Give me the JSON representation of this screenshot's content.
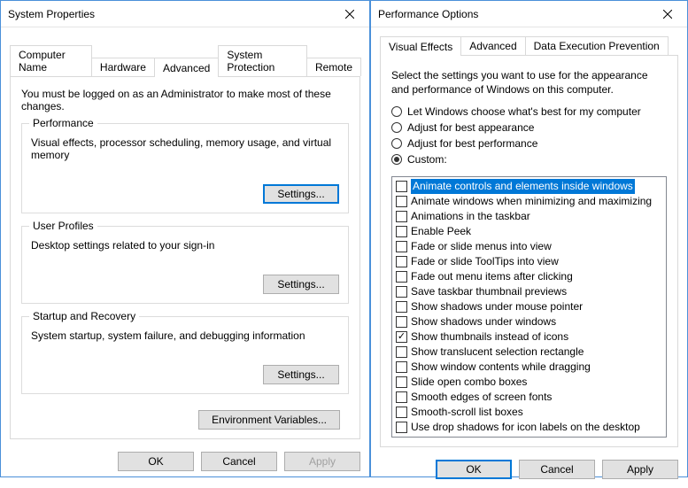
{
  "left": {
    "title": "System Properties",
    "tabs": [
      "Computer Name",
      "Hardware",
      "Advanced",
      "System Protection",
      "Remote"
    ],
    "active_tab": 2,
    "intro": "You must be logged on as an Administrator to make most of these changes.",
    "groups": {
      "performance": {
        "legend": "Performance",
        "desc": "Visual effects, processor scheduling, memory usage, and virtual memory",
        "button": "Settings..."
      },
      "userprofiles": {
        "legend": "User Profiles",
        "desc": "Desktop settings related to your sign-in",
        "button": "Settings..."
      },
      "startup": {
        "legend": "Startup and Recovery",
        "desc": "System startup, system failure, and debugging information",
        "button": "Settings..."
      }
    },
    "envbtn": "Environment Variables...",
    "footer": {
      "ok": "OK",
      "cancel": "Cancel",
      "apply": "Apply"
    }
  },
  "right": {
    "title": "Performance Options",
    "tabs": [
      "Visual Effects",
      "Advanced",
      "Data Execution Prevention"
    ],
    "active_tab": 0,
    "instr": "Select the settings you want to use for the appearance and performance of Windows on this computer.",
    "radios": [
      {
        "label": "Let Windows choose what's best for my computer",
        "selected": false
      },
      {
        "label": "Adjust for best appearance",
        "selected": false
      },
      {
        "label": "Adjust for best performance",
        "selected": false
      },
      {
        "label": "Custom:",
        "selected": true
      }
    ],
    "checks": [
      {
        "label": "Animate controls and elements inside windows",
        "checked": false,
        "selected": true
      },
      {
        "label": "Animate windows when minimizing and maximizing",
        "checked": false,
        "selected": false
      },
      {
        "label": "Animations in the taskbar",
        "checked": false,
        "selected": false
      },
      {
        "label": "Enable Peek",
        "checked": false,
        "selected": false
      },
      {
        "label": "Fade or slide menus into view",
        "checked": false,
        "selected": false
      },
      {
        "label": "Fade or slide ToolTips into view",
        "checked": false,
        "selected": false
      },
      {
        "label": "Fade out menu items after clicking",
        "checked": false,
        "selected": false
      },
      {
        "label": "Save taskbar thumbnail previews",
        "checked": false,
        "selected": false
      },
      {
        "label": "Show shadows under mouse pointer",
        "checked": false,
        "selected": false
      },
      {
        "label": "Show shadows under windows",
        "checked": false,
        "selected": false
      },
      {
        "label": "Show thumbnails instead of icons",
        "checked": true,
        "selected": false
      },
      {
        "label": "Show translucent selection rectangle",
        "checked": false,
        "selected": false
      },
      {
        "label": "Show window contents while dragging",
        "checked": false,
        "selected": false
      },
      {
        "label": "Slide open combo boxes",
        "checked": false,
        "selected": false
      },
      {
        "label": "Smooth edges of screen fonts",
        "checked": false,
        "selected": false
      },
      {
        "label": "Smooth-scroll list boxes",
        "checked": false,
        "selected": false
      },
      {
        "label": "Use drop shadows for icon labels on the desktop",
        "checked": false,
        "selected": false
      }
    ],
    "footer": {
      "ok": "OK",
      "cancel": "Cancel",
      "apply": "Apply"
    }
  }
}
